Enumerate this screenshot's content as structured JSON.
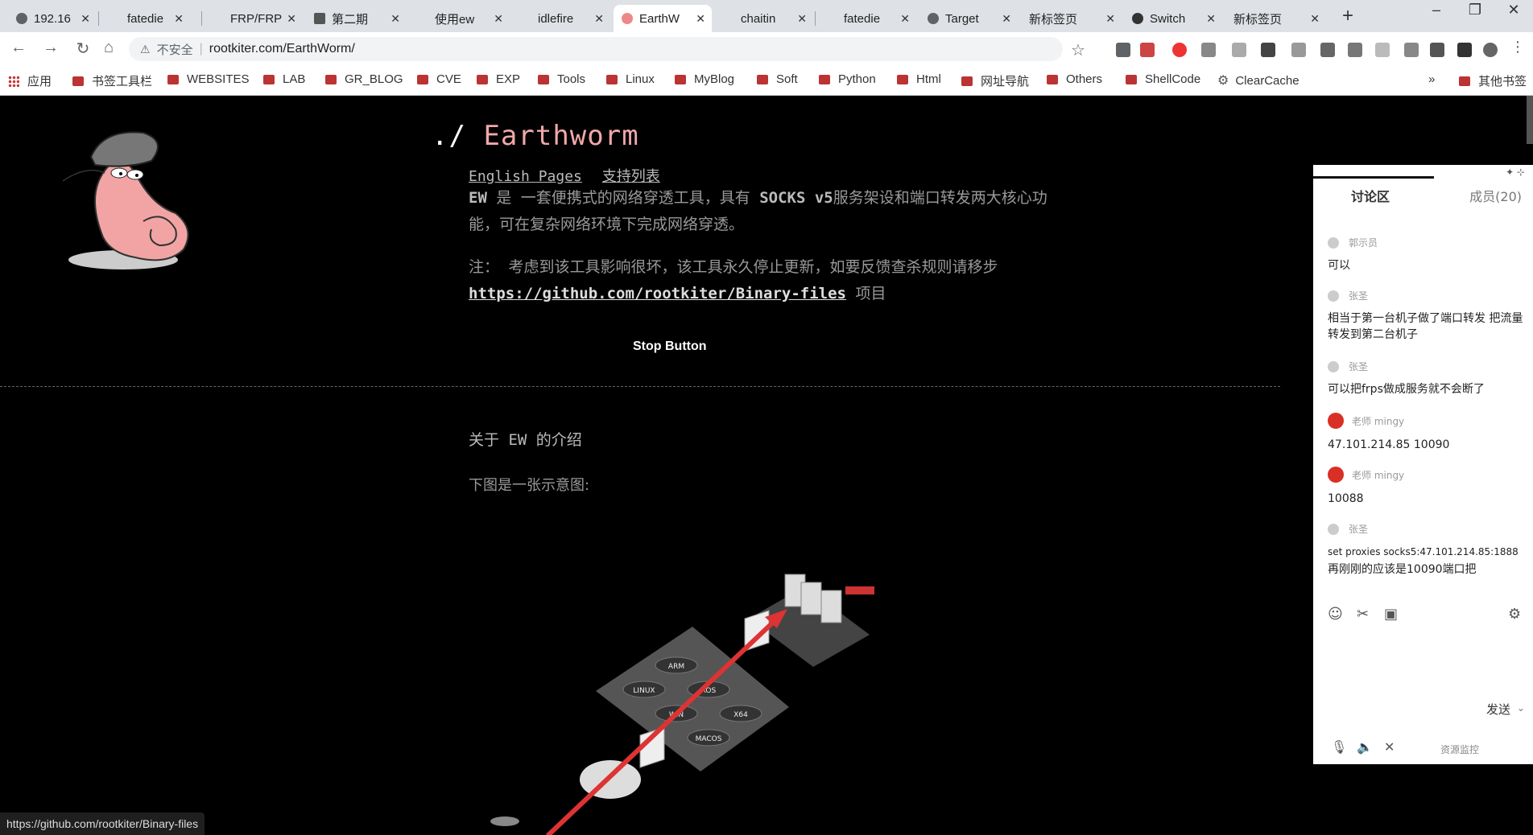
{
  "browser": {
    "tabs": [
      {
        "label": "192.16",
        "active": false
      },
      {
        "label": "fatedie",
        "active": false
      },
      {
        "label": "FRP/FRP",
        "active": false
      },
      {
        "label": "第二期",
        "active": false
      },
      {
        "label": "使用ew",
        "active": false
      },
      {
        "label": "idlefire",
        "active": false
      },
      {
        "label": "EarthW",
        "active": true
      },
      {
        "label": "chaitin",
        "active": false
      },
      {
        "label": "fatedie",
        "active": false
      },
      {
        "label": "Target",
        "active": false
      },
      {
        "label": "新标签页",
        "active": false
      },
      {
        "label": "Switch",
        "active": false
      },
      {
        "label": "新标签页",
        "active": false
      }
    ],
    "address": {
      "security_label": "不安全",
      "url": "rootkiter.com/EarthWorm/"
    },
    "bookmarks": [
      "应用",
      "书签工具栏",
      "WEBSITES",
      "LAB",
      "GR_BLOG",
      "CVE",
      "EXP",
      "Tools",
      "Linux",
      "MyBlog",
      "Soft",
      "Python",
      "Html",
      "网址导航",
      "Others",
      "ShellCode",
      "ClearCache"
    ],
    "bookmarks_overflow": "»",
    "other_bookmarks": "其他书签",
    "status_url": "https://github.com/rootkiter/Binary-files"
  },
  "page": {
    "title_prefix": "./",
    "title": "Earthworm",
    "link_english": "English Pages",
    "link_support": "支持列表",
    "desc_ew": "EW",
    "desc_part1": " 是 一套便携式的网络穿透工具，具有 ",
    "desc_socks": "SOCKS v5",
    "desc_part2": "服务架设和端口转发两大核心功能，可在复杂网络环境下完成网络穿透。",
    "note_part1": "注： 考虑到该工具影响很坏，该工具永久停止更新，如要反馈查杀规则请移步 ",
    "note_link": "https://github.com/rootkiter/Binary-files",
    "note_part2": " 项目",
    "stop_button": "Stop Button",
    "about_heading": "关于 EW 的介绍",
    "diagram_caption": "下图是一张示意图:",
    "diagram_labels": {
      "os_list": [
        "ARM",
        "LINUX",
        "XOS",
        "WIN",
        "X64",
        "MACOS"
      ]
    }
  },
  "discussion": {
    "tab_discussion": "讨论区",
    "tab_members": "成员(20)",
    "messages": [
      {
        "user": "郭示员",
        "text": "可以",
        "avatar": "gray"
      },
      {
        "user": "张圣",
        "text": "相当于第一台机子做了端口转发 把流量转发到第二台机子",
        "avatar": "gray"
      },
      {
        "user": "张圣",
        "text": "可以把frps做成服务就不会断了",
        "avatar": "gray"
      },
      {
        "user": "老师 mingy",
        "text": "47.101.214.85 10090",
        "avatar": "red"
      },
      {
        "user": "老师 mingy",
        "text": "10088",
        "avatar": "red"
      },
      {
        "user": "张圣",
        "text": "set proxies socks5:47.101.214.85:1888",
        "text2": "再刚刚的应该是10090端口把",
        "avatar": "gray"
      }
    ],
    "send_label": "发送",
    "net_monitor": "资源监控"
  }
}
